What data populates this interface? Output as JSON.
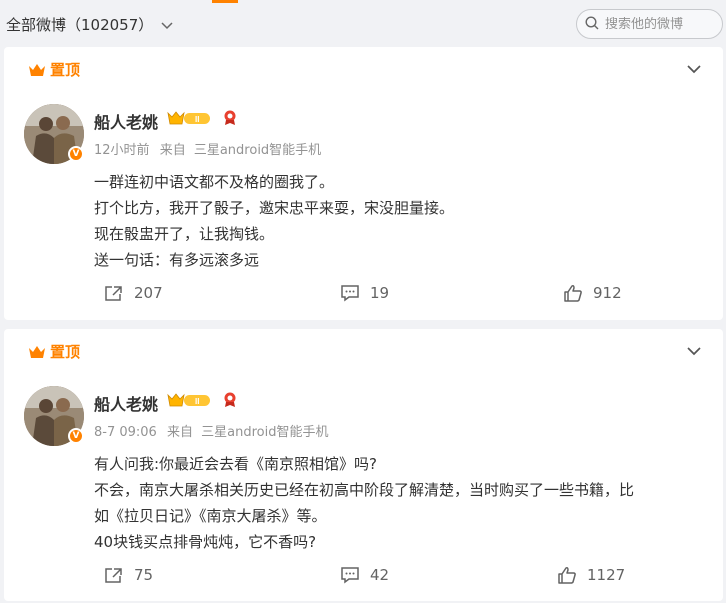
{
  "header": {
    "all_posts_label": "全部微博（102057）",
    "search_placeholder": "搜索他的微博"
  },
  "colors": {
    "accent": "#ff8200",
    "meta_text": "#939393",
    "action_text": "#636363",
    "background": "#f1f2f5"
  },
  "posts": [
    {
      "pin_label": "置顶",
      "username": "船人老姚",
      "time": "12小时前",
      "source_prefix": "来自",
      "source": "三星android智能手机",
      "lines": [
        "一群连初中语文都不及格的圈我了。",
        "打个比方，我开了骰子，邀宋忠平来耍，宋没胆量接。",
        "现在骰盅开了，让我掏钱。",
        "送一句话：有多远滚多远"
      ],
      "reposts": "207",
      "comments": "19",
      "likes": "912"
    },
    {
      "pin_label": "置顶",
      "username": "船人老姚",
      "time": "8-7 09:06",
      "source_prefix": "来自",
      "source": "三星android智能手机",
      "lines": [
        "有人问我:你最近会去看《南京照相馆》吗?",
        "不会，南京大屠杀相关历史已经在初高中阶段了解清楚，当时购买了一些书籍，比",
        "如《拉贝日记》《南京大屠杀》等。",
        "40块钱买点排骨炖炖，它不香吗?"
      ],
      "reposts": "75",
      "comments": "42",
      "likes": "1127"
    }
  ]
}
